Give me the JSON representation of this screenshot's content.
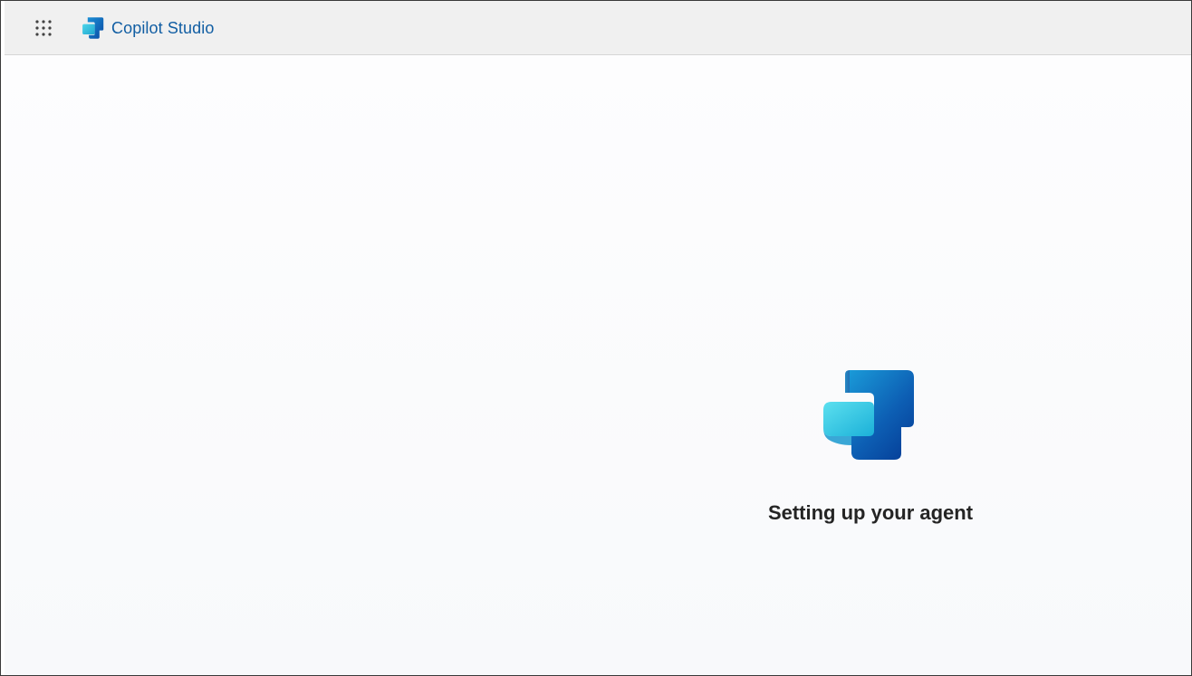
{
  "header": {
    "app_launcher_icon": "waffle-grid-icon",
    "brand_icon": "copilot-studio-logo-icon",
    "brand_name": "Copilot Studio"
  },
  "main": {
    "loading_icon": "copilot-studio-logo-icon",
    "status_text": "Setting up your agent"
  },
  "colors": {
    "header_bg": "#f0f0f0",
    "brand_text": "#115ea3",
    "status_text": "#242424",
    "logo_light": "#36c5e0",
    "logo_dark": "#0f5fb3"
  }
}
